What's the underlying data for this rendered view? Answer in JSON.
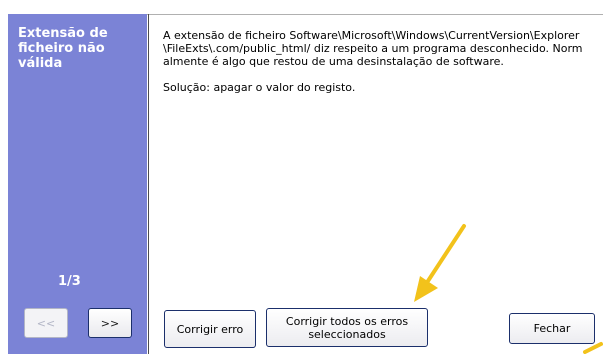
{
  "sidebar": {
    "title": "Extensão de\nficheiro não\nválida",
    "counter": "1/3",
    "prev_label": "<<",
    "next_label": ">>"
  },
  "main": {
    "description": "A extensão de ficheiro Software\\Microsoft\\Windows\\CurrentVersion\\Explorer\\FileExts\\.com/public_html/ diz respeito a um programa desconhecido. Normalmente é algo que restou de uma desinstalação de software.",
    "solution": "Solução: apagar o valor do registo."
  },
  "buttons": {
    "fix_one": "Corrigir erro",
    "fix_all": "Corrigir todos os erros seleccionados",
    "close": "Fechar"
  },
  "colors": {
    "sidebar": "#7b83d6",
    "arrow": "#f2c21b"
  }
}
